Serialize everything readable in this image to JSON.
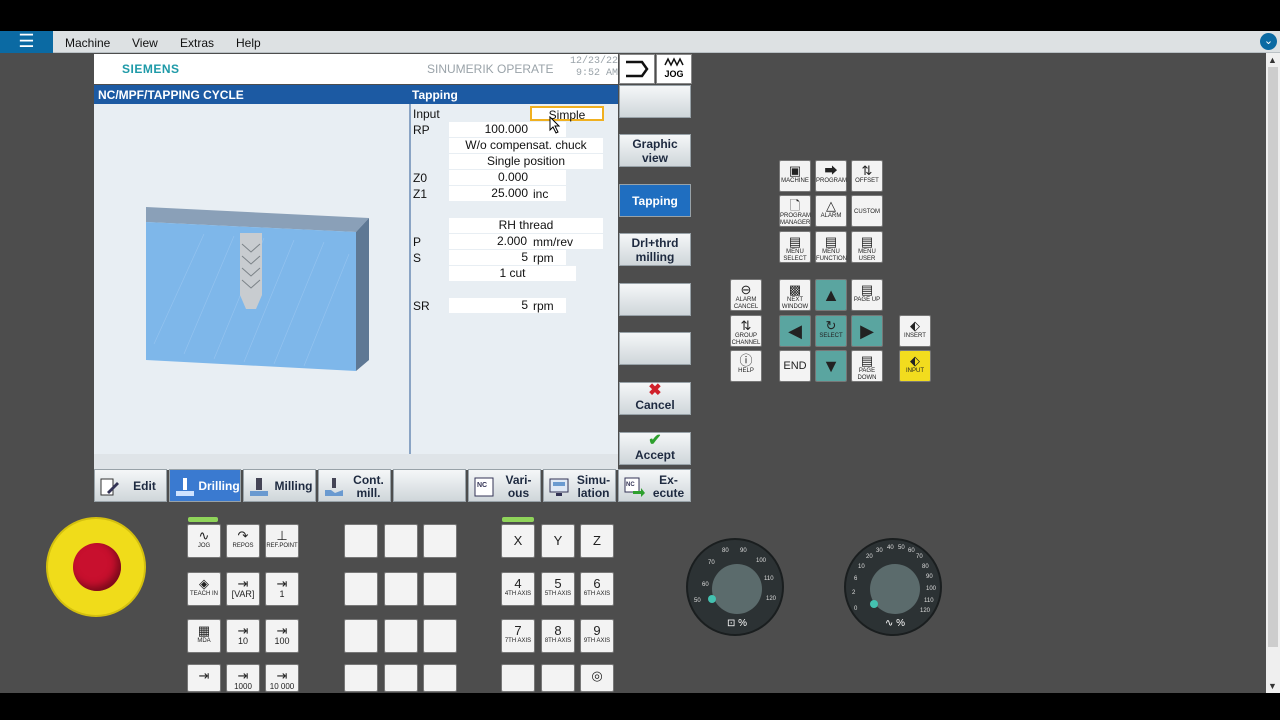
{
  "menubar": {
    "items": [
      "Machine",
      "View",
      "Extras",
      "Help"
    ]
  },
  "hmi": {
    "brand": "SIEMENS",
    "product": "SINUMERIK OPERATE",
    "date": "12/23/22",
    "time": "9:52 AM",
    "mode_label": "JOG"
  },
  "title": {
    "path": "NC/MPF/TAPPING CYCLE",
    "cycle": "Tapping"
  },
  "params": {
    "input": {
      "label": "Input",
      "value": "Simple"
    },
    "rp": {
      "label": "RP",
      "value": "100.000"
    },
    "comp": {
      "value": "W/o compensat. chuck"
    },
    "pos": {
      "value": "Single position"
    },
    "z0": {
      "label": "Z0",
      "value": "0.000"
    },
    "z1": {
      "label": "Z1",
      "value": "25.000",
      "unit": "inc"
    },
    "thread": {
      "value": "RH thread"
    },
    "p": {
      "label": "P",
      "value": "2.000",
      "unit": "mm/rev"
    },
    "s": {
      "label": "S",
      "value": "5",
      "unit": "rpm"
    },
    "cut": {
      "value": "1 cut"
    },
    "sr": {
      "label": "SR",
      "value": "5",
      "unit": "rpm"
    }
  },
  "vsoftkeys": {
    "graphic": "Graphic view",
    "tapping": "Tapping",
    "drl_thrd": "Drl+thrd milling",
    "cancel": "Cancel",
    "accept": "Accept"
  },
  "hsoftkeys": {
    "edit": "Edit",
    "drilling": "Drilling",
    "milling": "Milling",
    "cont_mill": "Cont. mill.",
    "various": "Vari- ous",
    "simulation": "Simu- lation",
    "execute": "Ex- ecute"
  },
  "keypad": {
    "machine": "MACHINE",
    "program": "PROGRAM",
    "offset": "OFFSET",
    "prog_manager": "PROGRAM MANAGER",
    "alarm": "ALARM",
    "custom": "CUSTOM",
    "menu_select": "MENU SELECT",
    "menu_function": "MENU FUNCTION",
    "menu_user": "MENU USER",
    "alarm_cancel": "ALARM CANCEL",
    "next_window": "NEXT WINDOW",
    "page_up": "PAGE UP",
    "group_channel": "GROUP CHANNEL",
    "select": "SELECT",
    "insert": "INSERT",
    "help": "HELP",
    "end": "END",
    "page_down": "PAGE DOWN",
    "input": "INPUT"
  },
  "mcp": {
    "jog": "JOG",
    "repos": "REPOS",
    "ref_point": "REF.POINT",
    "teach_in": "TEACH IN",
    "var": "[VAR]",
    "inc1": "1",
    "mda": "MDA",
    "inc10": "10",
    "inc100": "100",
    "inc1000": "1000",
    "inc10000": "10 000",
    "x": "X",
    "y": "Y",
    "z": "Z",
    "ax4": "4",
    "ax4sub": "4TH AXIS",
    "ax5": "5",
    "ax5sub": "5TH AXIS",
    "ax6": "6",
    "ax6sub": "6TH AXIS",
    "ax7": "7",
    "ax7sub": "7TH AXIS",
    "ax8": "8",
    "ax8sub": "8TH AXIS",
    "ax9": "9",
    "ax9sub": "9TH AXIS",
    "feed_label": "%",
    "spindle_label": "%",
    "feed_ticks": [
      "60",
      "70",
      "80",
      "90",
      "100",
      "110",
      "120",
      "50"
    ],
    "spindle_ticks": [
      "0",
      "2",
      "6",
      "10",
      "20",
      "30",
      "40",
      "50",
      "60",
      "70",
      "80",
      "90",
      "100",
      "110",
      "120"
    ]
  },
  "colors": {
    "accent": "#1c5aa3",
    "brand": "#1e9aa8",
    "estop": "#c8102e",
    "estop_ring": "#f0dc1a"
  }
}
